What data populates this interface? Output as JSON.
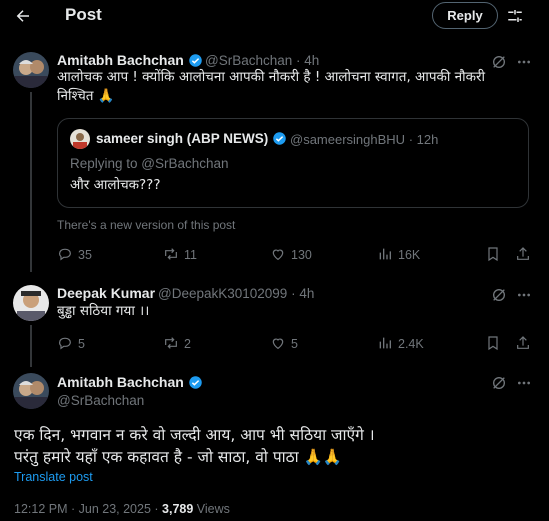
{
  "header": {
    "title": "Post",
    "reply_button": "Reply"
  },
  "original_post": {
    "author_name": "Amitabh Bachchan",
    "handle": "@SrBachchan",
    "time": "4h",
    "text_line1": "आलोचक आप ! क्योंकि आलोचना आपकी नौकरी है ! आलोचना स्वागत, आपकी नौकरी",
    "text_line2": "निश्चित 🙏",
    "quote": {
      "author_name": "sameer singh (ABP NEWS)",
      "handle": "@sameersinghBHU",
      "time": "12h",
      "replying_to": "Replying to @SrBachchan",
      "text": "और आलोचक???"
    },
    "notice": "There's a new version of this post",
    "stats": {
      "replies": "35",
      "reposts": "11",
      "likes": "130",
      "views": "16K"
    }
  },
  "reply_post": {
    "author_name": "Deepak Kumar",
    "handle": "@DeepakK30102099",
    "time": "4h",
    "text": "बुड्ढा सठिया गया ।।",
    "stats": {
      "replies": "5",
      "reposts": "2",
      "likes": "5",
      "views": "2.4K"
    }
  },
  "main_post": {
    "author_name": "Amitabh Bachchan",
    "handle": "@SrBachchan",
    "text_line1": "एक दिन, भगवान न करे वो जल्दी आय, आप भी सठिया जाएँगे ।",
    "text_line2": "परंतु हमारे यहाँ एक कहावत है  - जो साठा, वो पाठा 🙏🙏",
    "translate": "Translate post",
    "timestamp": "12:12 PM · Jun 23, 2025 · ",
    "views_count": "3,789",
    "views_label": " Views"
  },
  "colors": {
    "accent": "#1d9bf0",
    "verified": "#1d9bf0",
    "muted": "#71767b",
    "background": "#000000"
  }
}
